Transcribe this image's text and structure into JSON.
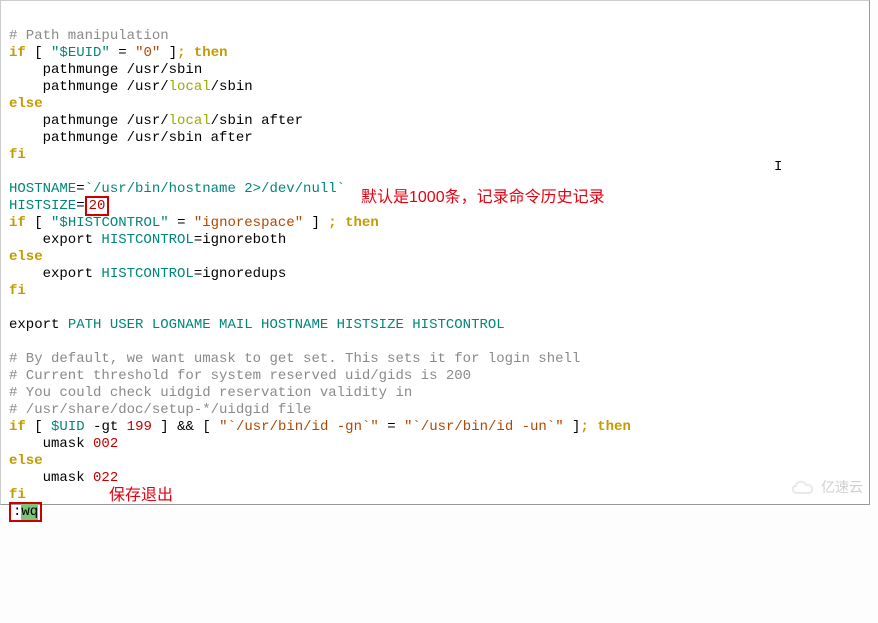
{
  "code": {
    "l1_comment": "# Path manipulation",
    "l2_if": "if",
    "l2_lb": "[",
    "l2_var": "\"$EUID\"",
    "l2_eq": "=",
    "l2_zero": "\"0\"",
    "l2_rb": "]",
    "l2_semi_then": "; then",
    "l3": "    pathmunge /usr/sbin",
    "l4_pre": "    pathmunge /usr/",
    "l4_local": "local",
    "l4_post": "/sbin",
    "l5_else": "else",
    "l6_pre": "    pathmunge /usr/",
    "l6_local": "local",
    "l6_post": "/sbin after",
    "l7": "    pathmunge /usr/sbin after",
    "l8_fi": "fi",
    "blank1": "",
    "l9_host": "HOSTNAME",
    "l9_eq": "=",
    "l9_val": "`/usr/bin/hostname 2>/dev/null`",
    "l10_hist": "HISTSIZE",
    "l10_eq": "=",
    "l10_val": "20",
    "l11_if": "if",
    "l11_lb": "[",
    "l11_var": "\"$HISTCONTROL\"",
    "l11_eq": "=",
    "l11_str": "\"ignorespace\"",
    "l11_rb": "]",
    "l11_semi_then": " ; then",
    "l12_pre": "    export ",
    "l12_var": "HISTCONTROL",
    "l12_eq": "=",
    "l12_val": "ignoreboth",
    "l13_else": "else",
    "l14_pre": "    export ",
    "l14_var": "HISTCONTROL",
    "l14_eq": "=",
    "l14_val": "ignoredups",
    "l15_fi": "fi",
    "blank2": "",
    "l16_pre": "export ",
    "l16_vars": "PATH USER LOGNAME MAIL HOSTNAME HISTSIZE HISTCONTROL",
    "blank3": "",
    "l17": "# By default, we want umask to get set. This sets it for login shell",
    "l18": "# Current threshold for system reserved uid/gids is 200",
    "l19": "# You could check uidgid reservation validity in",
    "l20": "# /usr/share/doc/setup-*/uidgid file",
    "l21_if": "if",
    "l21_lb": "[",
    "l21_uid": "$UID",
    "l21_gt": "-gt",
    "l21_num": "199",
    "l21_rb": "]",
    "l21_and": "&&",
    "l21_lb2": "[",
    "l21_str1": "\"`/usr/bin/id -gn`\"",
    "l21_eq": "=",
    "l21_str2": "\"`/usr/bin/id -un`\"",
    "l21_rb2": "]",
    "l21_semi_then": "; then",
    "l22_pre": "    umask ",
    "l22_val": "002",
    "l23_else": "else",
    "l24_pre": "    umask ",
    "l24_val": "022",
    "l25_fi": "fi",
    "l26_colon": ":",
    "l26_wq": "wq"
  },
  "annotations": {
    "hist_note": "默认是1000条，记录命令历史记录",
    "save_quit": "保存退出"
  },
  "misc": {
    "caret": "I",
    "watermark": "亿速云"
  }
}
